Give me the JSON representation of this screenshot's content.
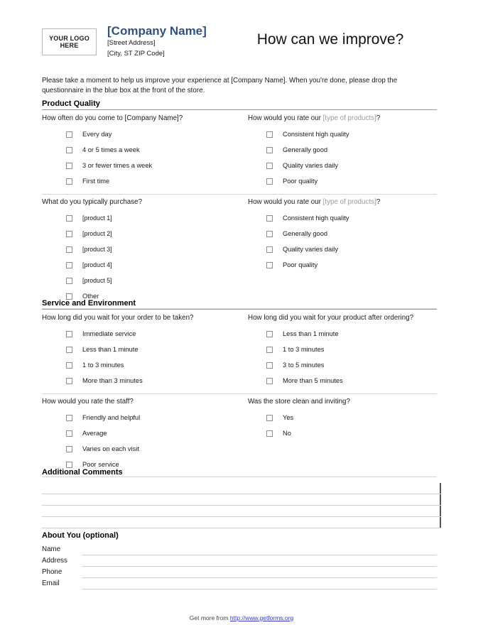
{
  "header": {
    "logo_line1": "YOUR LOGO",
    "logo_line2": "HERE",
    "company_name": "[Company Name]",
    "street_address": "[Street Address]",
    "city_state_zip": "[City, ST  ZIP Code]",
    "form_title": "How can we improve?",
    "brand_color": "#31527c"
  },
  "intro": "Please take a moment to help us improve your experience at [Company Name]. When you're done, please drop the questionnaire in the blue box at the front of the store.",
  "sections": [
    {
      "title": "Product Quality",
      "rows": [
        {
          "left": {
            "question": "How often do you come to [Company Name]?",
            "options": [
              "Every day",
              "4 or 5 times a week",
              "3 or fewer times a week",
              "First time"
            ]
          },
          "right": {
            "question_pre": "How would you rate our ",
            "question_dim": "[type of products]",
            "question_post": "?",
            "options": [
              "Consistent high quality",
              "Generally good",
              "Quality varies daily",
              "Poor quality"
            ]
          }
        },
        {
          "left": {
            "question": "What do you typically purchase?",
            "options": [
              "[product 1]",
              "[product 2]",
              "[product 3]",
              "[product 4]",
              "[product 5]",
              "Other"
            ]
          },
          "right": {
            "question_pre": "How would you rate our ",
            "question_dim": "[type of products]",
            "question_post": "?",
            "options": [
              "Consistent high quality",
              "Generally good",
              "Quality varies daily",
              "Poor quality"
            ]
          }
        }
      ]
    },
    {
      "title": "Service and Environment",
      "rows": [
        {
          "left": {
            "question": "How long did you wait for your order to be taken?",
            "options": [
              "Immediate service",
              "Less than 1 minute",
              "1 to 3 minutes",
              "More than 3 minutes"
            ]
          },
          "right": {
            "question": "How long did you wait for your product after ordering?",
            "options": [
              "Less than 1 minute",
              "1 to 3 minutes",
              "3 to 5 minutes",
              "More than 5 minutes"
            ]
          }
        },
        {
          "left": {
            "question": "How would you rate the staff?",
            "options": [
              "Friendly and helpful",
              "Average",
              "Varies on each visit",
              "Poor service"
            ]
          },
          "right": {
            "question": "Was the store clean and inviting?",
            "options": [
              "Yes",
              "No"
            ]
          }
        }
      ]
    }
  ],
  "comments": {
    "title": "Additional Comments",
    "line_count": 4
  },
  "about_you": {
    "title": "About You (optional)",
    "fields": [
      {
        "label": "Name",
        "value": ""
      },
      {
        "label": "Address",
        "value": ""
      },
      {
        "label": "Phone",
        "value": ""
      },
      {
        "label": "Email",
        "value": ""
      }
    ]
  },
  "footer": {
    "text": "Get more from ",
    "url": "http://www.getforms.org",
    "url_color": "#3737c8"
  }
}
